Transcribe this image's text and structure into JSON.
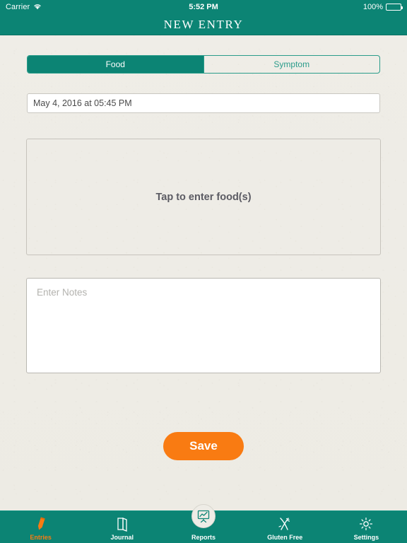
{
  "status_bar": {
    "carrier": "Carrier",
    "wifi_icon": "wifi-icon",
    "time": "5:52 PM",
    "battery_percent": "100%",
    "battery_icon": "battery-full-icon"
  },
  "navbar": {
    "title": "NEW ENTRY"
  },
  "segmented_control": {
    "options": [
      {
        "label": "Food",
        "selected": true
      },
      {
        "label": "Symptom",
        "selected": false
      }
    ]
  },
  "date_field": {
    "value": "May 4, 2016 at 05:45 PM"
  },
  "food_box": {
    "label": "Tap to enter food(s)"
  },
  "notes_box": {
    "placeholder": "Enter Notes",
    "value": ""
  },
  "save_button": {
    "label": "Save"
  },
  "tab_bar": {
    "items": [
      {
        "label": "Entries",
        "icon": "pencil-icon",
        "active": true
      },
      {
        "label": "Journal",
        "icon": "book-icon",
        "active": false
      },
      {
        "label": "Reports",
        "icon": "chart-easel-icon",
        "active": false
      },
      {
        "label": "Gluten Free",
        "icon": "wheat-crossed-icon",
        "active": false
      },
      {
        "label": "Settings",
        "icon": "gear-icon",
        "active": false
      }
    ]
  },
  "colors": {
    "teal": "#0c8474",
    "teal_light": "#2a9c8a",
    "orange": "#f97b12",
    "paper": "#eeece6",
    "text_dark": "#4a4a4a",
    "placeholder": "#b3b2ae"
  }
}
